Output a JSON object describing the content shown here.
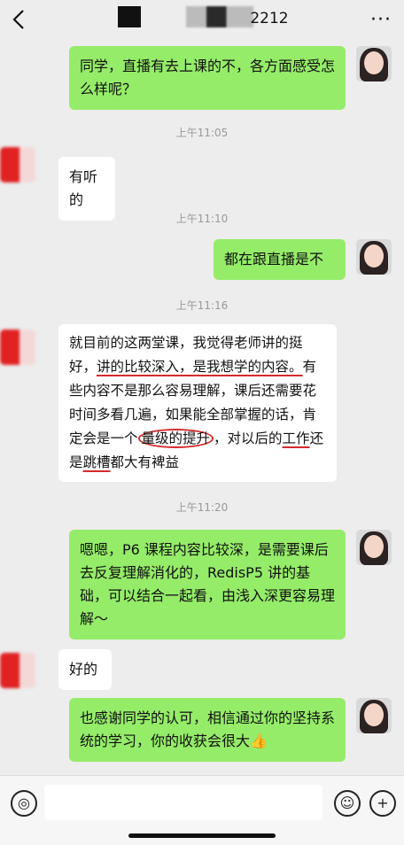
{
  "header": {
    "title": "2212",
    "back_icon": "chevron-left-icon",
    "more_icon": "more-dots-icon"
  },
  "messages": [
    {
      "from": "me",
      "text": "同学，直播有去上课的不，各方面感受怎么样呢？"
    },
    {
      "time": "上午11:05"
    },
    {
      "from": "them",
      "text": "有听的"
    },
    {
      "time": "上午11:10"
    },
    {
      "from": "me",
      "text": "都在跟直播是不"
    },
    {
      "time": "上午11:16"
    },
    {
      "from": "them",
      "text": "就目前的这两堂课，我觉得老师讲的挺好，讲的比较深入，是我想学的内容。有些内容不是那么容易理解，课后还需要花时间多看几遍，如果能全部掌握的话，肯定会是一个量级的提升，对以后的工作还是跳槽都大有裨益"
    },
    {
      "time": "上午11:20"
    },
    {
      "from": "me",
      "text": "嗯嗯，P6 课程内容比较深，是需要课后去反复理解消化的，RedisP5 讲的基础，可以结合一起看，由浅入深更容易理解～"
    },
    {
      "from": "them",
      "text": "好的"
    },
    {
      "from": "me",
      "text": "也感谢同学的认可，相信通过你的坚持系统的学习，你的收获会很大👍"
    }
  ],
  "composer": {
    "voice_icon": "voice-icon",
    "emoji_icon": "emoji-icon",
    "plus_icon": "plus-icon",
    "input_value": ""
  }
}
